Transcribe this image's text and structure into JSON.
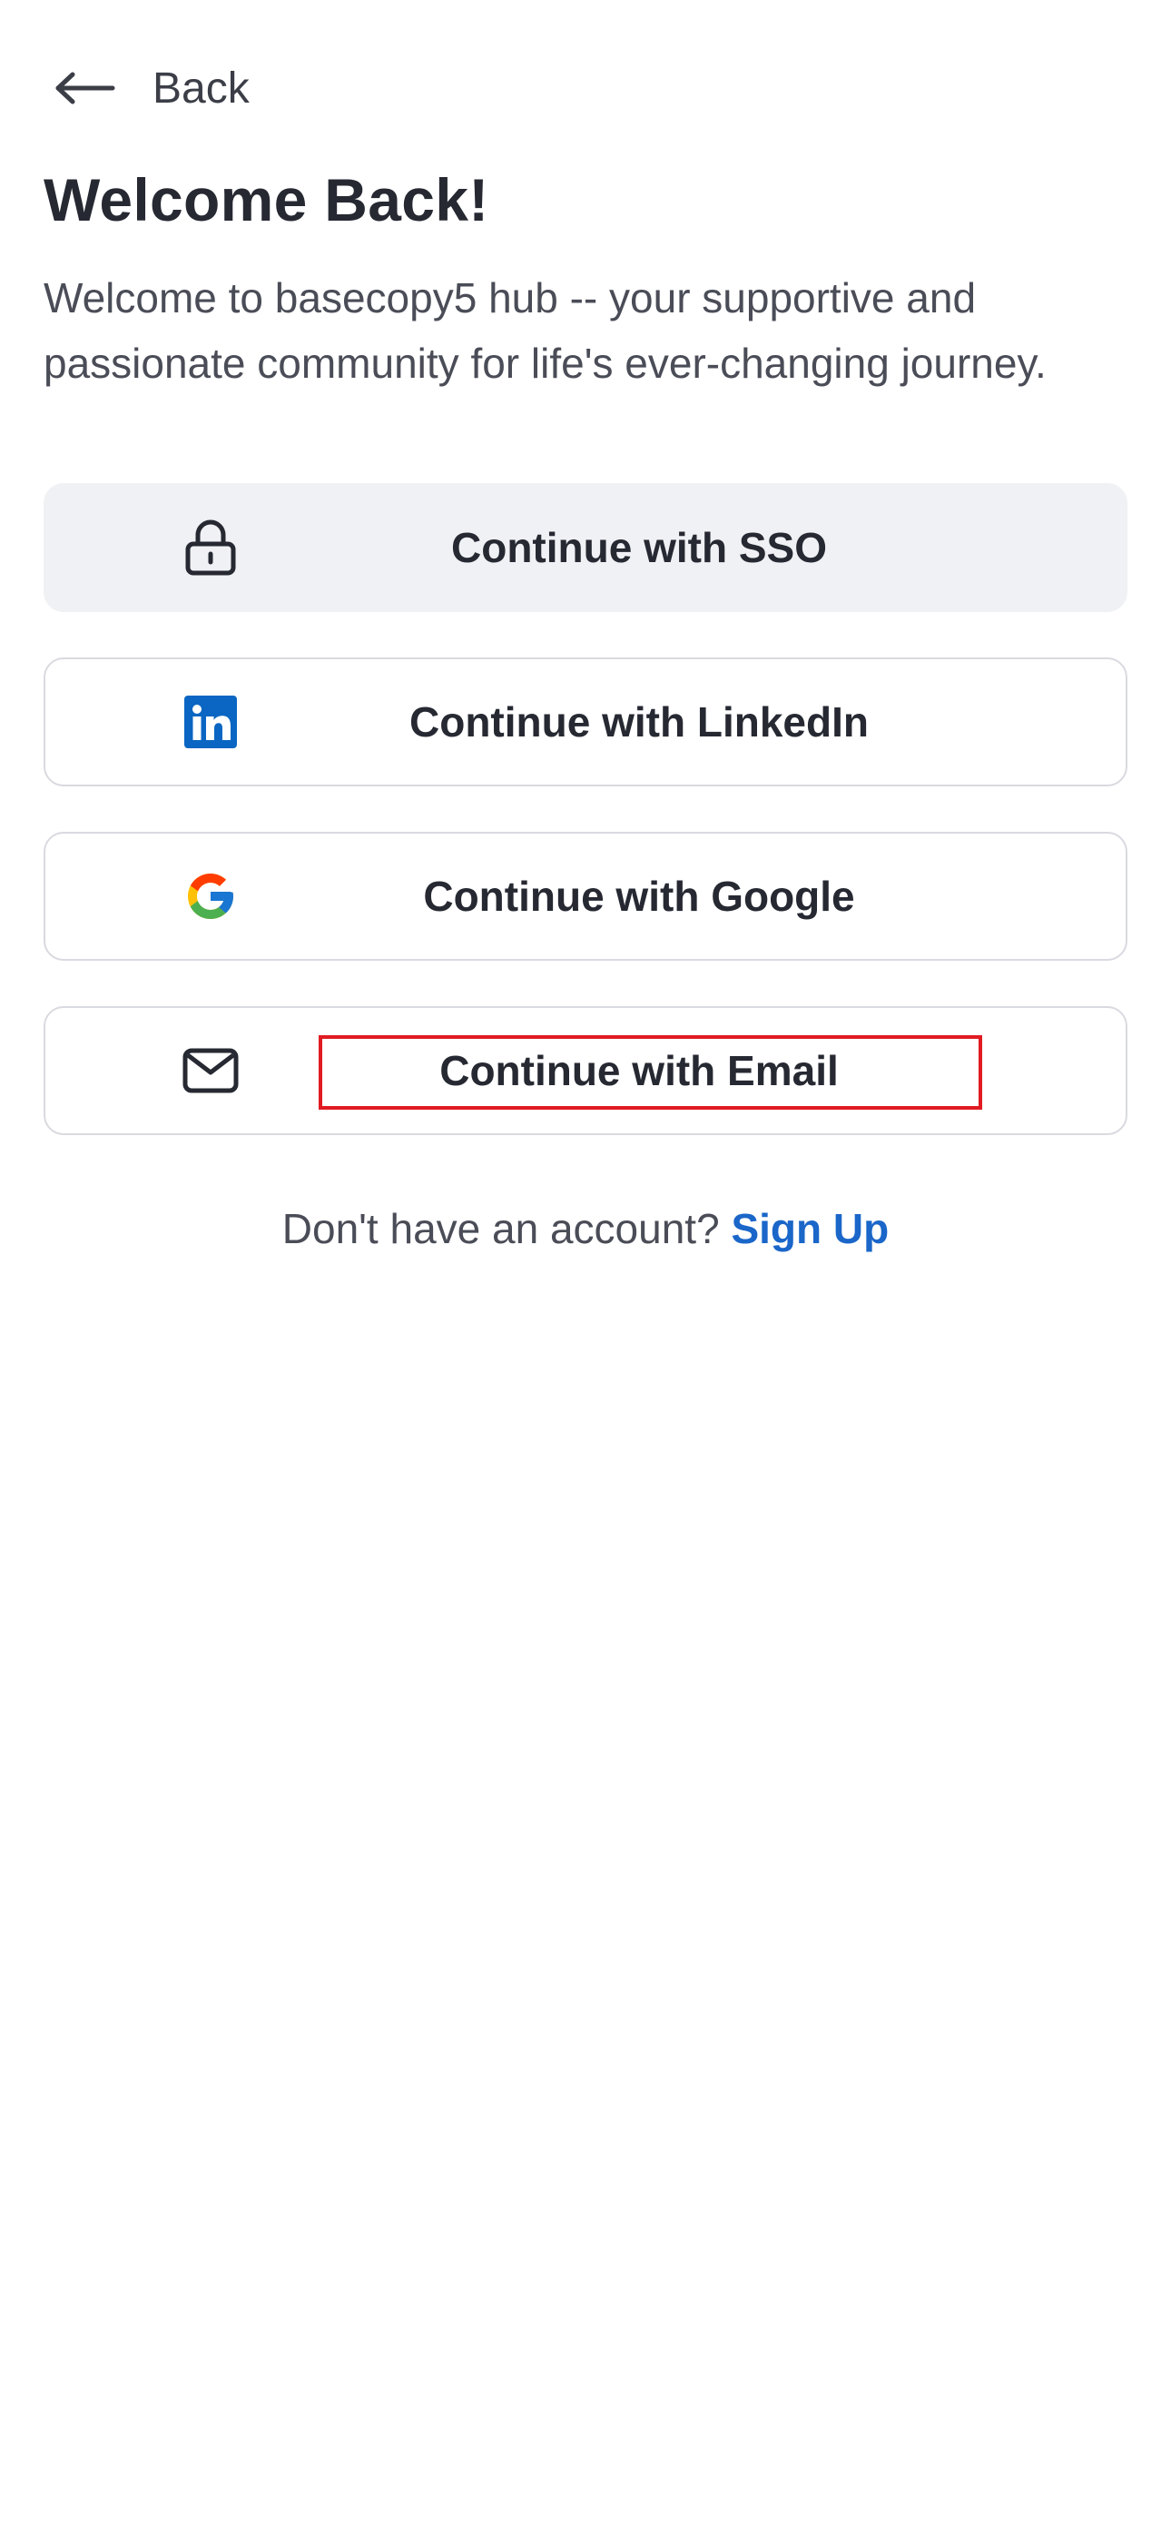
{
  "nav": {
    "back_label": "Back"
  },
  "header": {
    "title": "Welcome Back!",
    "subtitle": "Welcome to basecopy5 hub -- your supportive and passionate community for life's ever-changing journey."
  },
  "auth_buttons": [
    {
      "id": "sso",
      "label": "Continue with SSO",
      "icon": "lock-icon"
    },
    {
      "id": "linkedin",
      "label": "Continue with LinkedIn",
      "icon": "linkedin-icon"
    },
    {
      "id": "google",
      "label": "Continue with Google",
      "icon": "google-icon"
    },
    {
      "id": "email",
      "label": "Continue with Email",
      "icon": "mail-icon"
    }
  ],
  "signup": {
    "prompt": "Don't have an account?",
    "link_label": "Sign Up"
  },
  "colors": {
    "text": "#262932",
    "muted_text": "#4a4d57",
    "sso_bg": "#f0f1f4",
    "border": "#d9dae0",
    "link": "#1a66c9",
    "linkedin": "#0a66c2",
    "highlight": "#e11b22"
  }
}
